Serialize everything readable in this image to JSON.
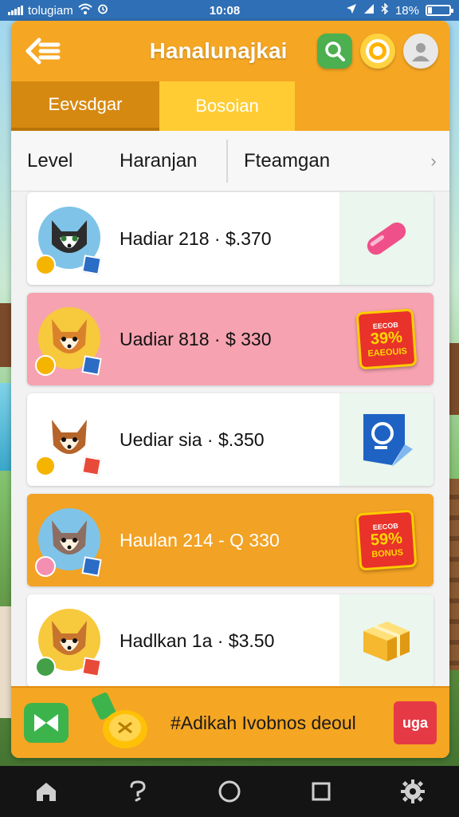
{
  "status_bar": {
    "carrier": "tolugiam",
    "time": "10:08",
    "battery": "18%",
    "battery_level": 0.18
  },
  "header": {
    "title": "Hanalunajkai"
  },
  "tabs": [
    {
      "label": "Eevsdgar"
    },
    {
      "label": "Bosoian"
    }
  ],
  "filters": {
    "level": "Level",
    "haranjan": "Haranjan",
    "fteamgan": "Fteamgan"
  },
  "rows": [
    {
      "text": "Hadiar 218 · $.370",
      "style": "white",
      "avatar": "blue",
      "reward": "pill-icon"
    },
    {
      "text": "Uadiar 818 · $ 330",
      "style": "pink",
      "avatar": "yellow",
      "reward": "bonus-badge",
      "badge": {
        "top": "EECOB",
        "pct": "39%",
        "label": "EAEOUIS"
      }
    },
    {
      "text": "Uediar sia · $.350",
      "style": "white",
      "avatar": "white",
      "reward": "shield-icon"
    },
    {
      "text": "Haulan 214 - Q 330",
      "style": "orange",
      "avatar": "blue",
      "reward": "bonus-badge",
      "badge": {
        "top": "EECOB",
        "pct": "59%",
        "label": "BONUS"
      }
    },
    {
      "text": "Hadlkan 1a · $3.50",
      "style": "white",
      "avatar": "yellow",
      "reward": "gift-box-icon"
    }
  ],
  "banner": {
    "text": "#Adikah Ivobnos deoul",
    "button": "uga"
  },
  "colors": {
    "primary": "#f5a623",
    "tab_active": "#d68910",
    "tab_secondary": "#ffcc33",
    "pink_row": "#f6a2b0",
    "badge_red": "#e8322a",
    "nav_bg": "#141414"
  }
}
